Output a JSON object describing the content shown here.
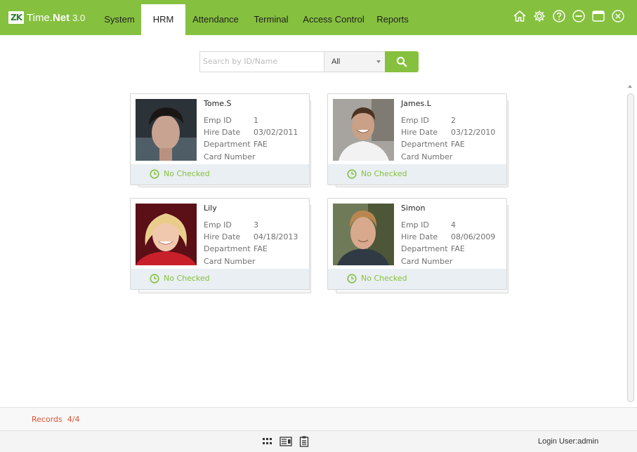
{
  "app": {
    "logo_badge": "ZK",
    "logo_name_light": "Time.",
    "logo_name_bold": "Net",
    "version": "3.0",
    "brand_color": "#86c03f"
  },
  "nav": {
    "tabs": [
      {
        "label": "System"
      },
      {
        "label": "HRM"
      },
      {
        "label": "Attendance"
      },
      {
        "label": "Terminal"
      },
      {
        "label": "Access Control"
      },
      {
        "label": "Reports"
      }
    ],
    "active": "HRM"
  },
  "window_controls": [
    "home-icon",
    "gear-icon",
    "help-icon",
    "minimize-icon",
    "maximize-icon",
    "close-icon"
  ],
  "search": {
    "placeholder": "Search by ID/Name",
    "value": "",
    "filter_selected": "All",
    "button_icon": "search-icon"
  },
  "labels": {
    "emp_id": "Emp ID",
    "hire_date": "Hire Date",
    "department": "Department",
    "card_number": "Card Number"
  },
  "employees": [
    {
      "name": "Tome.S",
      "emp_id": "1",
      "hire_date": "03/02/2011",
      "department": "FAE",
      "card_number": "",
      "status": "No Checked"
    },
    {
      "name": "James.L",
      "emp_id": "2",
      "hire_date": "03/12/2010",
      "department": "FAE",
      "card_number": "",
      "status": "No Checked"
    },
    {
      "name": "Lily",
      "emp_id": "3",
      "hire_date": "04/18/2013",
      "department": "FAE",
      "card_number": "",
      "status": "No Checked"
    },
    {
      "name": "Simon",
      "emp_id": "4",
      "hire_date": "08/06/2009",
      "department": "FAE",
      "card_number": "",
      "status": "No Checked"
    }
  ],
  "records": {
    "label": "Records",
    "value": "4/4"
  },
  "status_bar": {
    "view_icons": [
      "grid-view-icon",
      "card-view-icon",
      "list-view-icon"
    ],
    "login_user": "Login User:admin"
  },
  "colors": {
    "records_text": "#e0522e",
    "status_text": "#86c03f",
    "card_footer_bg": "#e9eff3"
  }
}
